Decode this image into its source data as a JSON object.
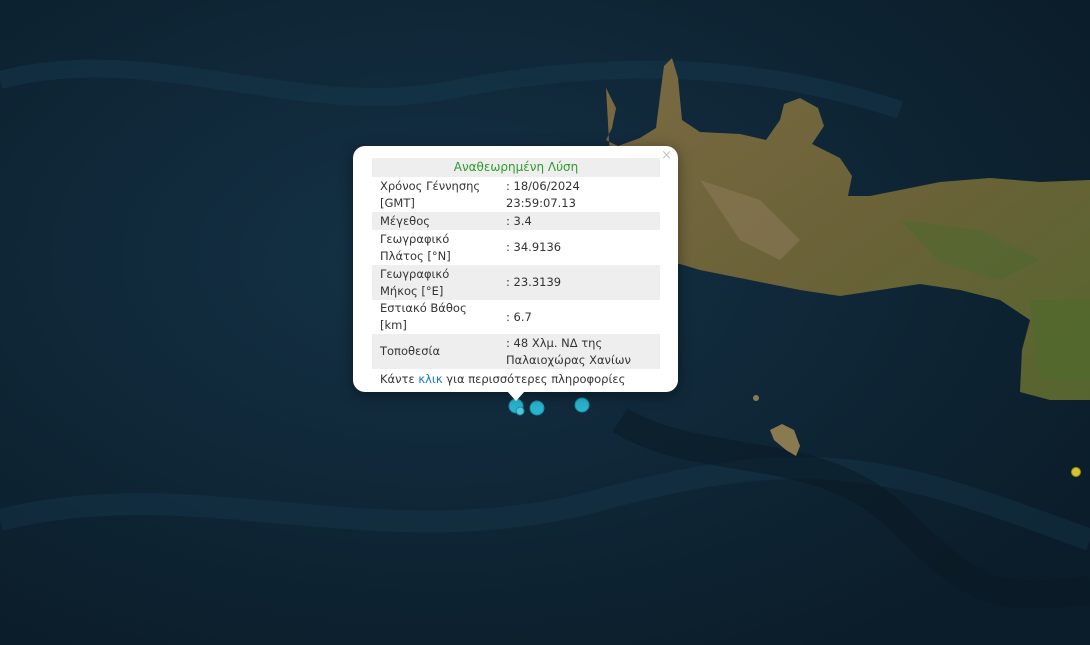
{
  "popup": {
    "title": "Αναθεωρημένη Λύση",
    "close_glyph": "×",
    "rows": [
      {
        "label": "Χρόνος Γέννησης [GMT]",
        "value": ": 18/06/2024 23:59:07.13"
      },
      {
        "label": "Μέγεθος",
        "value": ": 3.4"
      },
      {
        "label": "Γεωγραφικό Πλάτος [°N]",
        "value": ": 34.9136"
      },
      {
        "label": "Γεωγραφικό Μήκος [°E]",
        "value": ": 23.3139"
      },
      {
        "label": "Εστιακό Βάθος [km]",
        "value": ": 6.7"
      },
      {
        "label": "Τοποθεσία",
        "value": ": 48 Χλμ. ΝΔ της Παλαιοχώρας Χανίων"
      }
    ],
    "more": {
      "prefix": "Κάντε",
      "link": "κλικ",
      "suffix": "για περισσότερες πληροφορίες"
    },
    "title_color": "#2e9a2e",
    "link_color": "#1a73c9"
  },
  "map": {
    "sea_color": "#0e2433",
    "land_color": "#6b5a35",
    "marker_colors": {
      "recent": "#2ab3cf",
      "older": "#d9c22e"
    },
    "marker_icon": "circle-marker-icon",
    "close_icon": "close-icon"
  }
}
